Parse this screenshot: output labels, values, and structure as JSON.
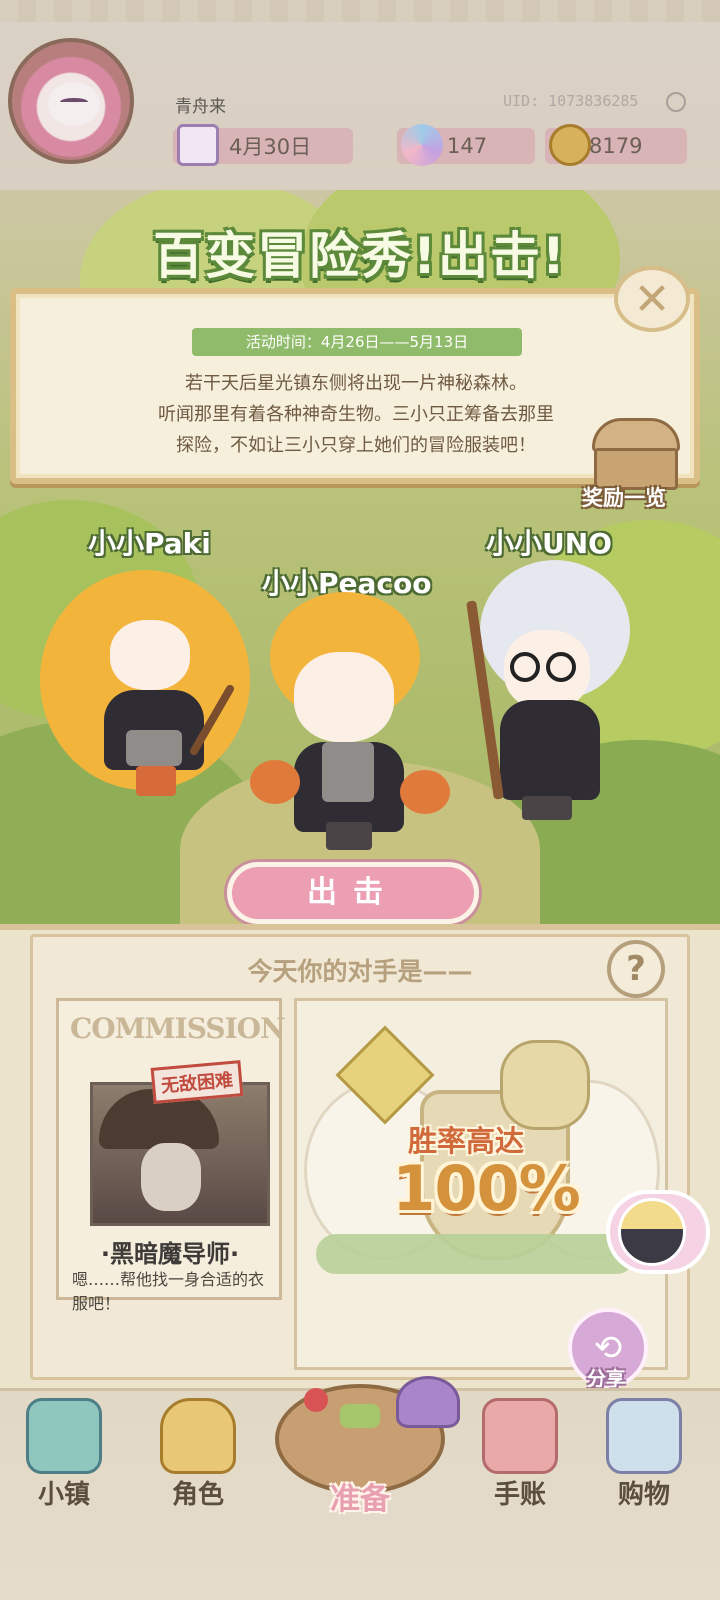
{
  "colors": {
    "accent_green": "#8fbb6a",
    "go_button_pink": "#ec9eb2",
    "parchment": "#f1e9d6",
    "active_tab_pink": "#e8a0b0"
  },
  "header": {
    "username": "青舟来",
    "uid": "UID: 1073836285",
    "date": "4月30日",
    "gems": "147",
    "coins": "8179",
    "icons": [
      "avatar",
      "calendar-icon",
      "gem-icon",
      "coin-icon"
    ]
  },
  "event": {
    "title": "百变冒险秀!出击!",
    "time_label": "活动时间：4月26日——5月13日",
    "desc_line1": "若干天后星光镇东侧将出现一片神秘森林。",
    "desc_line2": "听闻那里有着各种神奇生物。三小只正筹备去那里",
    "desc_line3": "探险，不如让三小只穿上她们的冒险服装吧！",
    "close_symbol": "✕",
    "reward_label": "奖励一览"
  },
  "characters": [
    {
      "name": "小小Paki"
    },
    {
      "name": "小小Peacoo"
    },
    {
      "name": "小小UNO"
    }
  ],
  "go_button": "出击",
  "opponent": {
    "section_title": "今天你的对手是——",
    "help_symbol": "?",
    "commission_label": "COMMISSION",
    "difficulty": "无敌困难",
    "name": "·黑暗魔导师·",
    "desc": "嗯……帮他找一身合适的衣服吧！",
    "win_rate_label": "胜率高达",
    "win_rate_value": "100%"
  },
  "share": {
    "label": "分享"
  },
  "bottom_nav": [
    {
      "label": "小镇",
      "icon": "map-icon"
    },
    {
      "label": "角色",
      "icon": "character-icon"
    },
    {
      "label": "准备",
      "icon": "basket-icon",
      "active": true
    },
    {
      "label": "手账",
      "icon": "journal-icon"
    },
    {
      "label": "购物",
      "icon": "shopping-bag-icon"
    }
  ]
}
